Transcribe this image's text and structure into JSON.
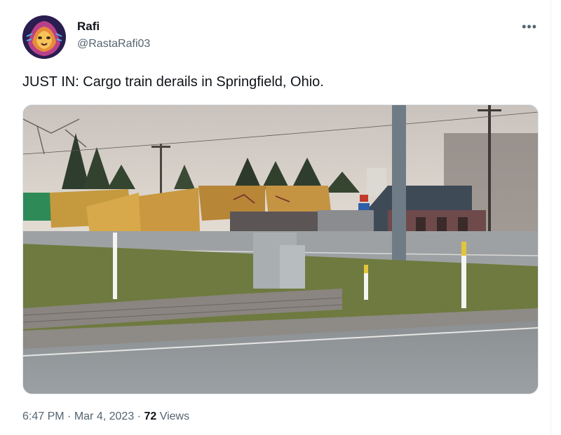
{
  "tweet": {
    "author_name": "Rafi",
    "author_handle": "@RastaRafi03",
    "more_icon": "•••",
    "text": "JUST IN: Cargo train derails in Springfield, Ohio.",
    "time": "6:47 PM",
    "separator": "·",
    "date": "Mar 4, 2023",
    "views_count": "72",
    "views_label": "Views"
  },
  "media": {
    "description_icon": "photo-derailed-train"
  }
}
